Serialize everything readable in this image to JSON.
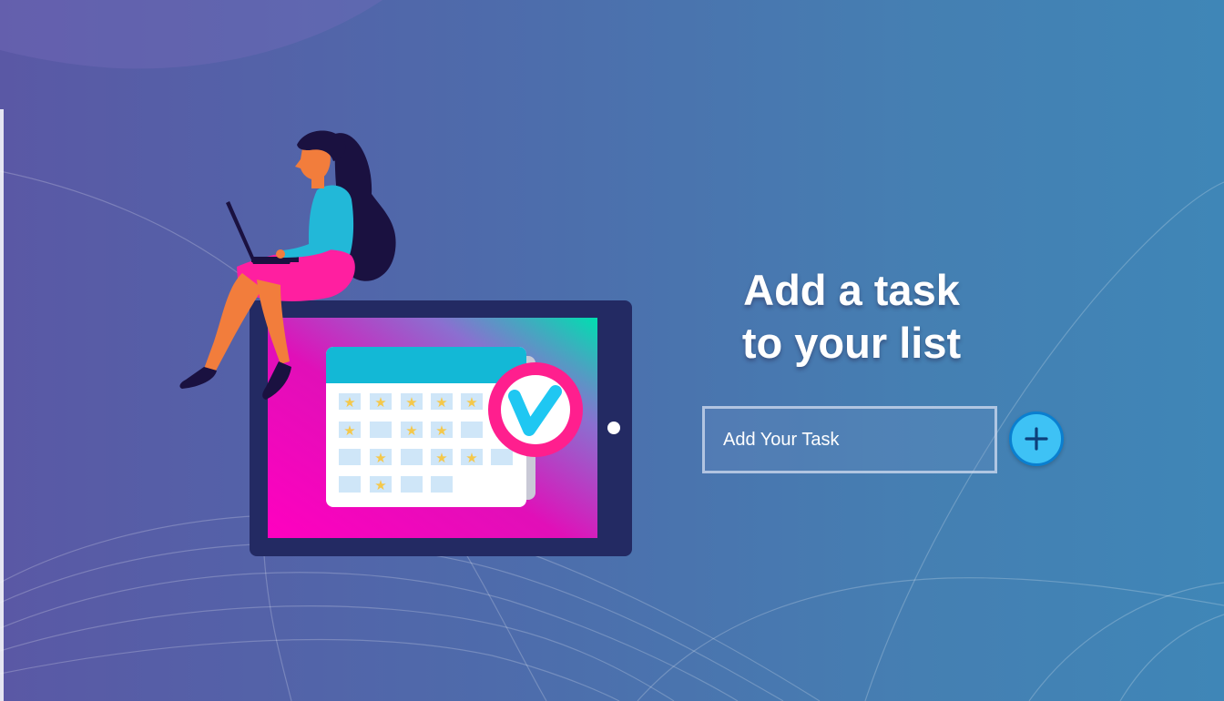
{
  "heading": {
    "line1": "Add a task",
    "line2": "to your list"
  },
  "task_input": {
    "placeholder": "Add Your Task",
    "value": ""
  },
  "add_button": {
    "icon": "plus-icon",
    "aria_label": "Add"
  },
  "illustration": {
    "name": "woman-with-laptop-on-tablet-calendar"
  },
  "colors": {
    "accent": "#3ec2f5",
    "accent_border": "#0a7fd0",
    "tablet_frame": "#232a63",
    "check_badge": "#ff1f8e"
  }
}
